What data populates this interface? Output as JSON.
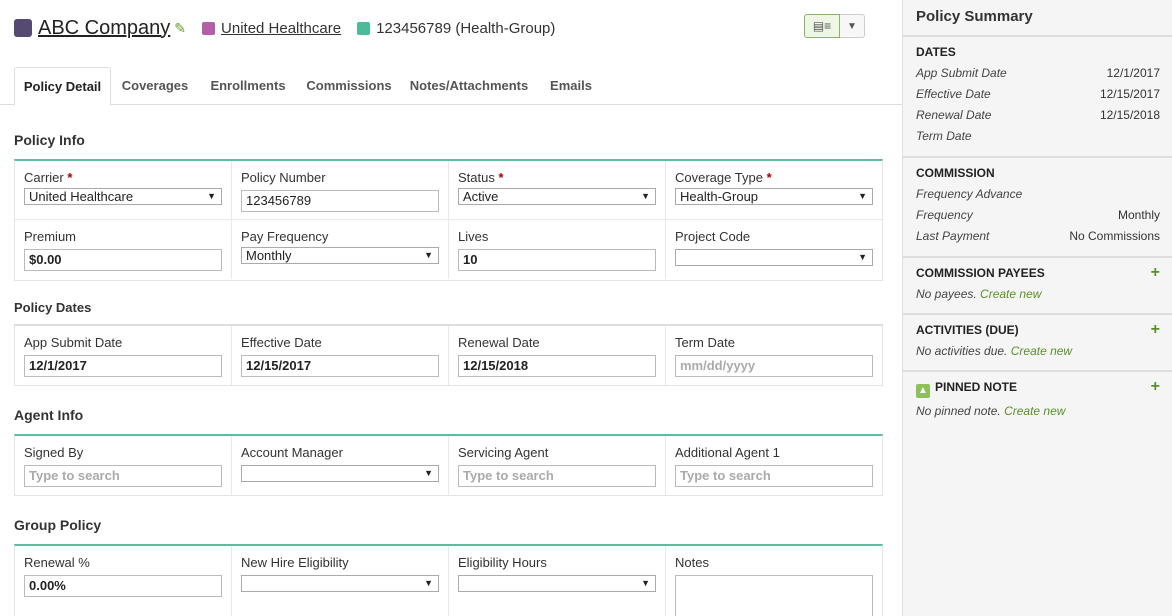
{
  "header": {
    "company_name": "ABC Company",
    "company_color": "#544a72",
    "carrier_name": "United Healthcare",
    "carrier_color": "#b25fa8",
    "group_id": "123456789 (Health-Group)",
    "group_color": "#4dbb9a"
  },
  "tabs": [
    "Policy Detail",
    "Coverages",
    "Enrollments",
    "Commissions",
    "Notes/Attachments",
    "Emails"
  ],
  "policy_info": {
    "title": "Policy Info",
    "carrier_label": "Carrier",
    "carrier_value": "United Healthcare",
    "policy_number_label": "Policy Number",
    "policy_number_value": "123456789",
    "status_label": "Status",
    "status_value": "Active",
    "coverage_type_label": "Coverage Type",
    "coverage_type_value": "Health-Group",
    "premium_label": "Premium",
    "premium_value": "$0.00",
    "pay_frequency_label": "Pay Frequency",
    "pay_frequency_value": "Monthly",
    "lives_label": "Lives",
    "lives_value": "10",
    "project_code_label": "Project Code",
    "project_code_value": ""
  },
  "policy_dates": {
    "title": "Policy Dates",
    "app_submit_label": "App Submit Date",
    "app_submit_value": "12/1/2017",
    "effective_label": "Effective Date",
    "effective_value": "12/15/2017",
    "renewal_label": "Renewal Date",
    "renewal_value": "12/15/2018",
    "term_label": "Term Date",
    "term_placeholder": "mm/dd/yyyy"
  },
  "agent_info": {
    "title": "Agent Info",
    "signed_by_label": "Signed By",
    "account_manager_label": "Account Manager",
    "servicing_agent_label": "Servicing Agent",
    "additional_agent_label": "Additional Agent 1",
    "search_placeholder": "Type to search"
  },
  "group_policy": {
    "title": "Group Policy",
    "renewal_pct_label": "Renewal %",
    "renewal_pct_value": "0.00%",
    "new_hire_label": "New Hire Eligibility",
    "eligibility_hours_label": "Eligibility Hours",
    "notes_label": "Notes"
  },
  "sidebar": {
    "title": "Policy Summary",
    "dates_heading": "DATES",
    "dates": [
      {
        "k": "App Submit Date",
        "v": "12/1/2017"
      },
      {
        "k": "Effective Date",
        "v": "12/15/2017"
      },
      {
        "k": "Renewal Date",
        "v": "12/15/2018"
      },
      {
        "k": "Term Date",
        "v": ""
      }
    ],
    "commission_heading": "COMMISSION",
    "commission": [
      {
        "k": "Frequency Advance",
        "v": ""
      },
      {
        "k": "Frequency",
        "v": "Monthly"
      },
      {
        "k": "Last Payment",
        "v": "No Commissions"
      }
    ],
    "payees_heading": "COMMISSION PAYEES",
    "payees_empty": "No payees.",
    "activities_heading": "ACTIVITIES (DUE)",
    "activities_empty": "No activities due.",
    "pinned_heading": "PINNED NOTE",
    "pinned_empty": "No pinned note.",
    "create_new": "Create new"
  }
}
